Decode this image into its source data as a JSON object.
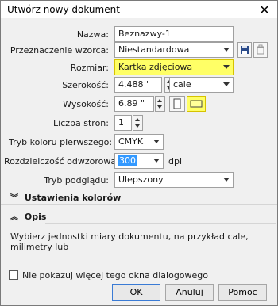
{
  "window": {
    "title": "Utwórz nowy dokument",
    "close_glyph": "✕"
  },
  "form": {
    "name_label": "Nazwa:",
    "name_value": "Beznazwy-1",
    "preset_label": "Przeznaczenie wzorca:",
    "preset_value": "Niestandardowa",
    "size_label": "Rozmiar:",
    "size_value": "Kartka zdjęciowa",
    "width_label": "Szerokość:",
    "width_value": "4.488 \"",
    "units_value": "cale",
    "height_label": "Wysokość:",
    "height_value": "6.89 \"",
    "pages_label": "Liczba stron:",
    "pages_value": "1",
    "color_mode_label": "Tryb koloru pierwszego:",
    "color_mode_value": "CMYK",
    "resolution_label": "Rozdzielczość odwzorowania:",
    "resolution_value": "300",
    "resolution_unit": "dpi",
    "preview_label": "Tryb podglądu:",
    "preview_value": "Ulepszony"
  },
  "sections": {
    "colors_title": "Ustawienia kolorów",
    "colors_chevron": "︾",
    "desc_title": "Opis",
    "desc_chevron": "︽",
    "desc_text": "Wybierz jednostki miary dokumentu, na przykład cale, milimetry lub"
  },
  "footer": {
    "dont_show_label": "Nie pokazuj więcej tego okna dialogowego",
    "ok_label": "OK",
    "cancel_label": "Anuluj",
    "help_label": "Pomoc"
  },
  "icons": {
    "save_preset": "save-icon",
    "delete_preset": "trash-icon",
    "portrait": "portrait-orientation-icon",
    "landscape": "landscape-orientation-icon"
  },
  "colors": {
    "highlight": "#ffff66",
    "selection": "#3399ff",
    "primary_button_border": "#3a7bd5"
  }
}
